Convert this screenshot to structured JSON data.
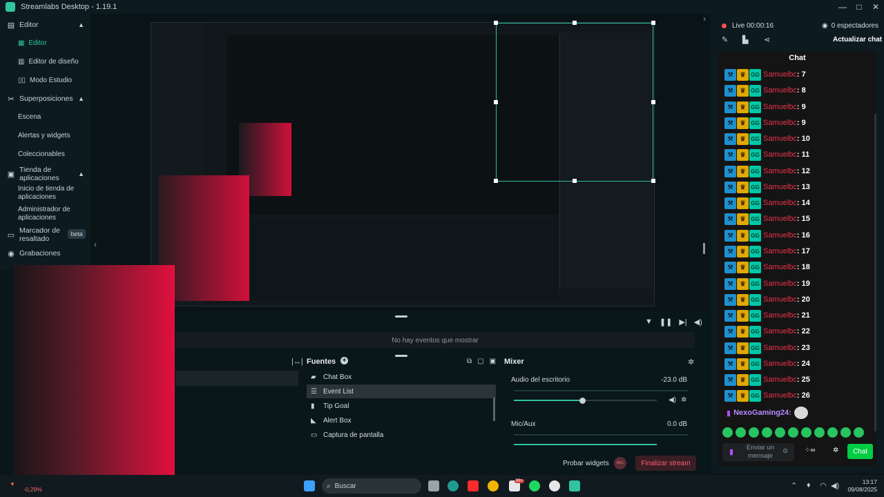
{
  "window": {
    "title": "Streamlabs Desktop - 1.19.1",
    "controls": [
      "—",
      "□",
      "✕"
    ]
  },
  "nav": {
    "editor_group": "Editor",
    "editor_items": [
      "Editor",
      "Editor de diseño",
      "Modo Estudio"
    ],
    "overlays_group": "Superposiciones",
    "overlays_items": [
      "Escena",
      "Alertas y widgets",
      "Coleccionables"
    ],
    "store_group": "Tienda de aplicaciones",
    "store_items": [
      "Inicio de tienda de aplicaciones",
      "Administrador de aplicaciones"
    ],
    "highlight": "Marcador de resaltado",
    "highlight_badge": "beta",
    "recordings": "Grabaciones"
  },
  "events": {
    "empty_text": "No hay eventos que mostrar"
  },
  "sources": {
    "title": "Fuentes",
    "items": [
      "Chat Box",
      "Event List",
      "Tip Goal",
      "Alert Box",
      "Captura de pantalla"
    ],
    "selected_index": 1
  },
  "mixer": {
    "title": "Mixer",
    "channels": [
      {
        "name": "Audio del escritorio",
        "db": "-23.0 dB",
        "level": 0.48
      },
      {
        "name": "Mic/Aux",
        "db": "0.0 dB",
        "level": 1.0
      }
    ]
  },
  "footer": {
    "test_widgets": "Probar widgets",
    "rec_label": "REC",
    "end_stream": "Finalizar stream"
  },
  "stream": {
    "live": "Live 00:00:16",
    "viewers": "0 espectadores",
    "refresh_chat": "Actualizar chat"
  },
  "chat": {
    "title": "Chat",
    "messages": [
      {
        "user": "Samuelbc",
        "text": ": 7"
      },
      {
        "user": "Samuelbc",
        "text": ": 8"
      },
      {
        "user": "Samuelbc",
        "text": ": 9"
      },
      {
        "user": "Samuelbc",
        "text": ": 9"
      },
      {
        "user": "Samuelbc",
        "text": ": 10"
      },
      {
        "user": "Samuelbc",
        "text": ": 11"
      },
      {
        "user": "Samuelbc",
        "text": ": 12"
      },
      {
        "user": "Samuelbc",
        "text": ": 13"
      },
      {
        "user": "Samuelbc",
        "text": ": 14"
      },
      {
        "user": "Samuelbc",
        "text": ": 15"
      },
      {
        "user": "Samuelbc",
        "text": ": 16"
      },
      {
        "user": "Samuelbc",
        "text": ": 17"
      },
      {
        "user": "Samuelbc",
        "text": ": 18"
      },
      {
        "user": "Samuelbc",
        "text": ": 19"
      },
      {
        "user": "Samuelbc",
        "text": ": 20"
      },
      {
        "user": "Samuelbc",
        "text": ": 21"
      },
      {
        "user": "Samuelbc",
        "text": ": 22"
      },
      {
        "user": "Samuelbc",
        "text": ": 23"
      },
      {
        "user": "Samuelbc",
        "text": ": 24"
      },
      {
        "user": "Samuelbc",
        "text": ": 25"
      },
      {
        "user": "Samuelbc",
        "text": ": 26"
      }
    ],
    "last_user": "NexoGaming24:",
    "input_placeholder": "Enviar un mensaje",
    "send_label": "Chat"
  },
  "inner_chat_counter": [
    "Samuelbc : 7"
  ],
  "cpu": "-0,29%",
  "taskbar": {
    "search": "Buscar",
    "time": "13:17",
    "date": "09/08/2025",
    "badge": "99+"
  },
  "colors": {
    "accent": "#31c3a2",
    "danger": "#ff5f72",
    "chat_user": "#e8324c",
    "send": "#00cc44"
  }
}
